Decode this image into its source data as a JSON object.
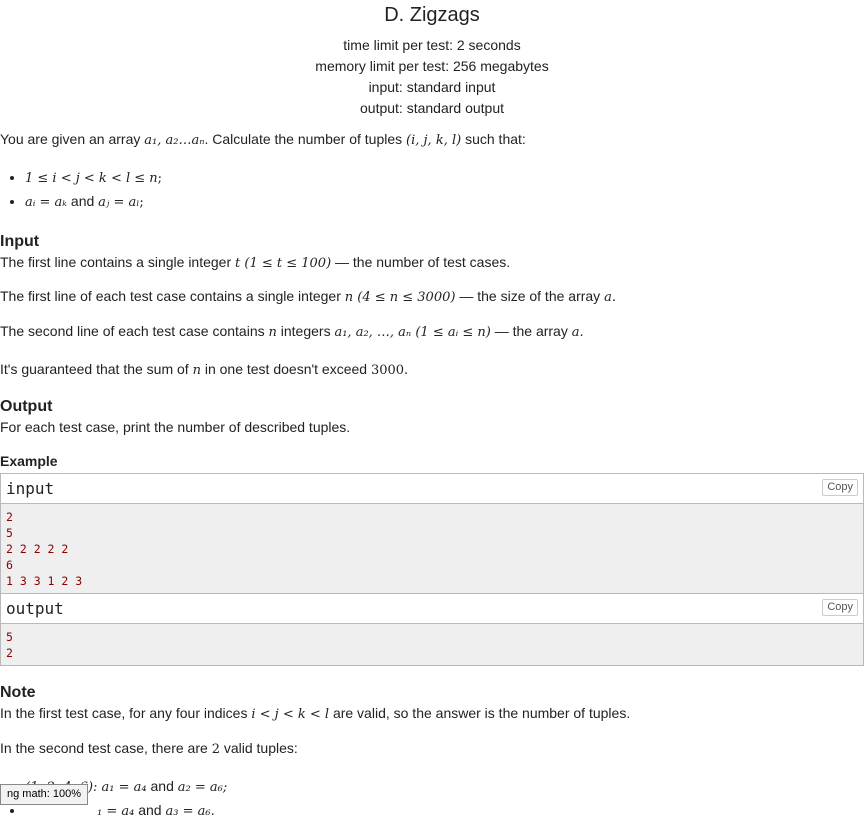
{
  "problem": {
    "title": "D. Zigzags",
    "time_limit": "time limit per test: 2 seconds",
    "memory_limit": "memory limit per test: 256 megabytes",
    "input": "input: standard input",
    "output": "output: standard output"
  },
  "statement": {
    "intro_text": "You are given an array",
    "intro_math_array": "a₁, a₂…aₙ",
    "intro_text2": ". Calculate the number of tuples",
    "intro_math_tuple": "(i, j, k, l)",
    "intro_text3": "such that:",
    "bullets": [
      {
        "math": "1 ≤ i < j < k < l ≤ n",
        "suffix": ";"
      },
      {
        "math1": "aᵢ = aₖ",
        "mid": "and",
        "math2": "aⱼ = aₗ",
        "suffix": ";"
      }
    ]
  },
  "input_section": {
    "heading": "Input",
    "p1_text": "The first line contains a single integer",
    "p1_math": "t (1 ≤ t ≤ 100)",
    "p1_text2": "— the number of test cases.",
    "p2_text": "The first line of each test case contains a single integer",
    "p2_math": "n (4 ≤ n ≤ 3000)",
    "p2_text2": "— the size of the array",
    "p2_math2": "a.",
    "p3_text": "The second line of each test case contains",
    "p3_math": "n",
    "p3_text2": "integers",
    "p3_math2": "a₁, a₂, …, aₙ (1 ≤ aᵢ ≤ n)",
    "p3_text3": "— the array",
    "p3_math3": "a.",
    "p4_text": "It's guaranteed that the sum of",
    "p4_math": "n",
    "p4_text2": "in one test doesn't exceed",
    "p4_math2": "3000."
  },
  "output_section": {
    "heading": "Output",
    "text": "For each test case, print the number of described tuples."
  },
  "example": {
    "heading": "Example",
    "input_title": "input",
    "input_lines": "2\n5\n2 2 2 2 2\n6\n1 3 3 1 2 3",
    "output_title": "output",
    "output_lines": "5\n2",
    "copy_label": "Copy"
  },
  "note": {
    "heading": "Note",
    "p1_text": "In the first test case, for any four indices",
    "p1_math": "i < j < k < l",
    "p1_text2": "are valid, so the answer is the number of tuples.",
    "p2_text": "In the second test case, there are",
    "p2_math": "2",
    "p2_text2": "valid tuples:",
    "bullet1_math": "(1, 2, 4, 6): a₁ = a₄",
    "bullet1_mid": "and",
    "bullet1_math2": "a₂ = a₆;",
    "bullet2_math": "₁ = a₄",
    "bullet2_mid": "and",
    "bullet2_math2": "a₃ = a₆."
  },
  "math_badge": "ng math: 100%"
}
